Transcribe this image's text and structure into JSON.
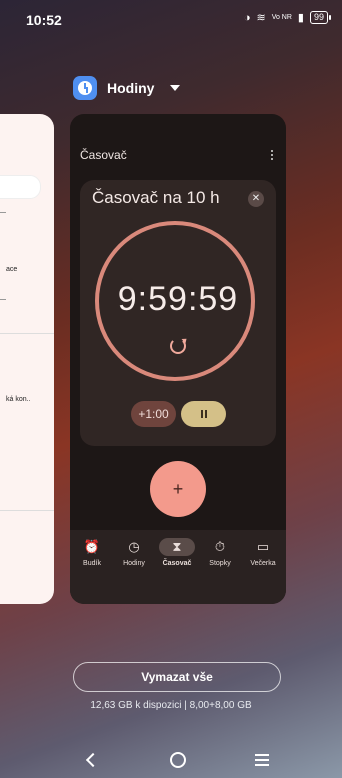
{
  "status": {
    "time": "10:52",
    "battery": "99",
    "network": "Vo NR"
  },
  "app": {
    "name": "Hodiny"
  },
  "left_card": {
    "text1": "ace",
    "text2": "ká kon.."
  },
  "card": {
    "title": "Časovač",
    "timer": {
      "name": "Časovač na 10 h",
      "remaining": "9:59:59",
      "add_label": "+1:00"
    },
    "fab_label": "+",
    "tabs": [
      {
        "label": "Budík",
        "icon": "alarm-icon"
      },
      {
        "label": "Hodiny",
        "icon": "clock-icon"
      },
      {
        "label": "Časovač",
        "icon": "hourglass-icon"
      },
      {
        "label": "Stopky",
        "icon": "stopwatch-icon"
      },
      {
        "label": "Večerka",
        "icon": "bed-icon"
      }
    ]
  },
  "clear_all": "Vymazat vše",
  "storage": "12,63 GB k dispozici | 8,00+8,00 GB"
}
